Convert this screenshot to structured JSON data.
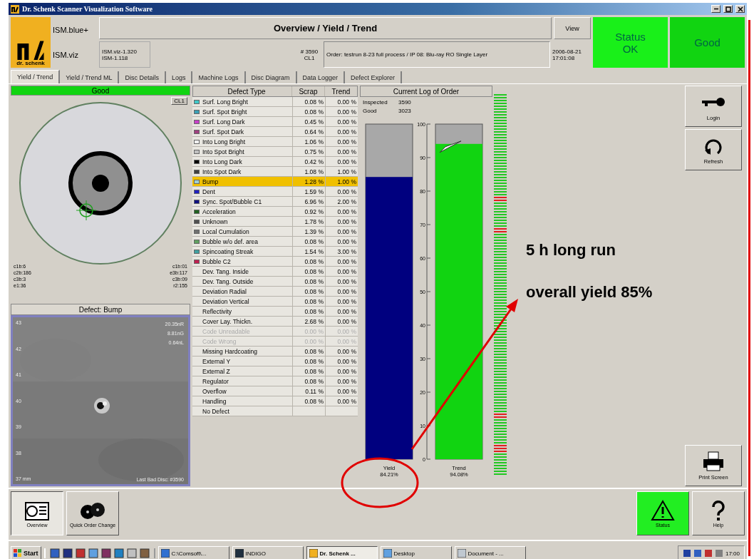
{
  "window": {
    "title": "Dr. Schenk Scanner Visualization Software"
  },
  "header": {
    "logo_text": "dr. schenk",
    "product": "ISM.blue+",
    "module": "ISM.viz",
    "versions": [
      "ISM.viz-1.320",
      "ISM-1.118"
    ],
    "title": "Overview / Yield / Trend",
    "view_button": "View",
    "disc_number": "# 3590",
    "line": "CL1",
    "order": "Order: testrun 8-23 full process / IP 08: Blu-ray RO Single Layer",
    "timestamp": [
      "2006-08-21",
      "17:01:08"
    ],
    "status": [
      {
        "text": "Status OK",
        "color": "#19f019"
      },
      {
        "text": "Good",
        "color": "#11d411"
      }
    ]
  },
  "tabs": [
    {
      "label": "Yield / Trend",
      "selected": true
    },
    {
      "label": "Yield / Trend ML",
      "selected": false
    },
    {
      "label": "Disc Details",
      "selected": false
    },
    {
      "label": "Logs",
      "selected": false
    },
    {
      "label": "Machine Logs",
      "selected": false
    },
    {
      "label": "Disc Diagram",
      "selected": false
    },
    {
      "label": "Data Logger",
      "selected": false
    },
    {
      "label": "Defect Explorer",
      "selected": false
    }
  ],
  "disc_panel": {
    "status": "Good",
    "channel": "CL1",
    "stats_left": [
      "c1b:6",
      "c2b:186",
      "c3b:3",
      "e1:36"
    ],
    "stats_right": [
      "c1b:01",
      "e3b:117",
      "c3b:09",
      "r2:155"
    ]
  },
  "defect_view": {
    "title": "Defect: Bump",
    "axis_labels": [
      "43",
      "42",
      "41",
      "40",
      "39",
      "38",
      "37 mm"
    ],
    "readings": [
      "20.35nR",
      "8.81nG",
      "0.64nL"
    ],
    "footer": "Last Bad Disc: #3590"
  },
  "defect_table": {
    "columns": [
      "Defect Type",
      "Scrap",
      "Trend"
    ],
    "rows": [
      {
        "name": "Surf. Long Bright",
        "scrap": "0.08 %",
        "trend": "0.00 %",
        "color": "#40c8c8",
        "selected": false,
        "disabled": false
      },
      {
        "name": "Surf. Spot Bright",
        "scrap": "0.08 %",
        "trend": "0.00 %",
        "color": "#3aa0b4",
        "selected": false,
        "disabled": false
      },
      {
        "name": "Surf. Long Dark",
        "scrap": "0.45 %",
        "trend": "0.00 %",
        "color": "#c840c8",
        "selected": false,
        "disabled": false
      },
      {
        "name": "Surf. Spot Dark",
        "scrap": "0.64 %",
        "trend": "0.00 %",
        "color": "#a04080",
        "selected": false,
        "disabled": false
      },
      {
        "name": "Into Long Bright",
        "scrap": "1.06 %",
        "trend": "0.00 %",
        "color": "#f0f0f0",
        "selected": false,
        "disabled": false
      },
      {
        "name": "Into Spot Bright",
        "scrap": "0.75 %",
        "trend": "0.00 %",
        "color": "#c0c0c0",
        "selected": false,
        "disabled": false
      },
      {
        "name": "Into Long Dark",
        "scrap": "0.42 %",
        "trend": "0.00 %",
        "color": "#000000",
        "selected": false,
        "disabled": false
      },
      {
        "name": "Into Spot Dark",
        "scrap": "1.08 %",
        "trend": "1.00 %",
        "color": "#404040",
        "selected": false,
        "disabled": false
      },
      {
        "name": "Bump",
        "scrap": "1.28 %",
        "trend": "1.00 %",
        "color": "#a0d0d0",
        "selected": true,
        "disabled": false
      },
      {
        "name": "Dent",
        "scrap": "1.59 %",
        "trend": "0.00 %",
        "color": "#2020c0",
        "selected": false,
        "disabled": false
      },
      {
        "name": "Sync. Spot/Bubble C1",
        "scrap": "6.96 %",
        "trend": "2.00 %",
        "color": "#101080",
        "selected": false,
        "disabled": false
      },
      {
        "name": "Acceleration",
        "scrap": "0.92 %",
        "trend": "0.00 %",
        "color": "#206020",
        "selected": false,
        "disabled": false
      },
      {
        "name": "Unknown",
        "scrap": "1.78 %",
        "trend": "0.00 %",
        "color": "#505050",
        "selected": false,
        "disabled": false
      },
      {
        "name": "Local Cumulation",
        "scrap": "1.39 %",
        "trend": "0.00 %",
        "color": "#707070",
        "selected": false,
        "disabled": false
      },
      {
        "name": "Bubble w/o def. area",
        "scrap": "0.08 %",
        "trend": "0.00 %",
        "color": "#60a060",
        "selected": false,
        "disabled": false
      },
      {
        "name": "Spincoating Streak",
        "scrap": "1.54 %",
        "trend": "3.00 %",
        "color": "#40a0a0",
        "selected": false,
        "disabled": false
      },
      {
        "name": "Bubble C2",
        "scrap": "0.08 %",
        "trend": "0.00 %",
        "color": "#c02050",
        "selected": false,
        "disabled": false
      },
      {
        "name": "Dev. Tang. Inside",
        "scrap": "0.08 %",
        "trend": "0.00 %",
        "selected": false,
        "disabled": false
      },
      {
        "name": "Dev. Tang. Outside",
        "scrap": "0.08 %",
        "trend": "0.00 %",
        "selected": false,
        "disabled": false
      },
      {
        "name": "Deviation Radial",
        "scrap": "0.08 %",
        "trend": "0.00 %",
        "selected": false,
        "disabled": false
      },
      {
        "name": "Deviation Vertical",
        "scrap": "0.08 %",
        "trend": "0.00 %",
        "selected": false,
        "disabled": false
      },
      {
        "name": "Reflectivity",
        "scrap": "0.08 %",
        "trend": "0.00 %",
        "selected": false,
        "disabled": false
      },
      {
        "name": "Cover Lay. Thickn.",
        "scrap": "2.68 %",
        "trend": "0.00 %",
        "selected": false,
        "disabled": false
      },
      {
        "name": "Code Unreadable",
        "scrap": "0.00 %",
        "trend": "0.00 %",
        "selected": false,
        "disabled": true
      },
      {
        "name": "Code Wrong",
        "scrap": "0.00 %",
        "trend": "0.00 %",
        "selected": false,
        "disabled": true
      },
      {
        "name": "Missing Hardcoating",
        "scrap": "0.08 %",
        "trend": "0.00 %",
        "selected": false,
        "disabled": false
      },
      {
        "name": "External Y",
        "scrap": "0.08 %",
        "trend": "0.00 %",
        "selected": false,
        "disabled": false
      },
      {
        "name": "External Z",
        "scrap": "0.08 %",
        "trend": "0.00 %",
        "selected": false,
        "disabled": false
      },
      {
        "name": "Regulator",
        "scrap": "0.08 %",
        "trend": "0.00 %",
        "selected": false,
        "disabled": false
      },
      {
        "name": "Overflow",
        "scrap": "0.11 %",
        "trend": "0.00 %",
        "selected": false,
        "disabled": false
      },
      {
        "name": "Handling",
        "scrap": "0.08 %",
        "trend": "0.00 %",
        "selected": false,
        "disabled": false
      },
      {
        "name": "No Defect",
        "selected": false,
        "disabled": false
      }
    ]
  },
  "order_log": {
    "title": "Current Log of Order",
    "counts": [
      {
        "label": "Inspected",
        "value": "3590"
      },
      {
        "label": "Good",
        "value": "3023"
      }
    ],
    "chart_data": {
      "type": "bar",
      "categories": [
        "Yield",
        "Trend"
      ],
      "values": [
        84.21,
        94.08
      ],
      "colors": [
        "#00007f",
        "#11d411"
      ],
      "ylim": [
        0,
        100
      ],
      "yticks": [
        0,
        10,
        20,
        30,
        40,
        50,
        60,
        70,
        80,
        90,
        100
      ],
      "value_labels": [
        "84.21%",
        "94.08%"
      ]
    }
  },
  "tools": [
    {
      "label": "Login",
      "kind": "key"
    },
    {
      "label": "Refresh",
      "kind": "refresh"
    },
    {
      "label": "Print Screen",
      "kind": "print"
    }
  ],
  "bottom_bar": {
    "left": [
      {
        "label": "Overview",
        "kind": "overview",
        "selected": true
      },
      {
        "label": "Quick Order Change",
        "kind": "discs",
        "selected": false
      }
    ],
    "right": [
      {
        "label": "Status",
        "kind": "warning"
      },
      {
        "label": "Help",
        "kind": "help"
      }
    ]
  },
  "taskbar": {
    "start": "Start",
    "tasks": [
      {
        "label": "C:\\Comsoft\\...",
        "selected": false
      },
      {
        "label": "INDIGO",
        "selected": false
      },
      {
        "label": "Dr. Schenk ...",
        "selected": true
      },
      {
        "label": "Desktop",
        "selected": false
      },
      {
        "label": "Document - ...",
        "selected": false
      }
    ],
    "clock": "17:00"
  },
  "annotations": [
    {
      "text": "5 h long run"
    },
    {
      "text": "overall yield 85%"
    }
  ]
}
